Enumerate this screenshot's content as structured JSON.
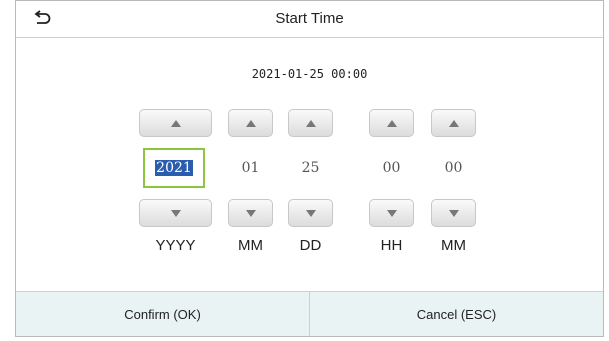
{
  "header": {
    "title": "Start Time",
    "back_icon": "back-arrow-icon"
  },
  "date_display": "2021-01-25 00:00",
  "spinners": [
    {
      "unit": "YYYY",
      "value": "2021",
      "active": true
    },
    {
      "unit": "MM",
      "value": "01",
      "active": false
    },
    {
      "unit": "DD",
      "value": "25",
      "active": false
    },
    {
      "unit": "HH",
      "value": "00",
      "active": false
    },
    {
      "unit": "MM",
      "value": "00",
      "active": false
    }
  ],
  "footer": {
    "confirm_label": "Confirm (OK)",
    "cancel_label": "Cancel (ESC)"
  },
  "colors": {
    "active_border": "#8cc63f",
    "selection_bg": "#2a5db0",
    "footer_bg": "#e9f3f3"
  }
}
